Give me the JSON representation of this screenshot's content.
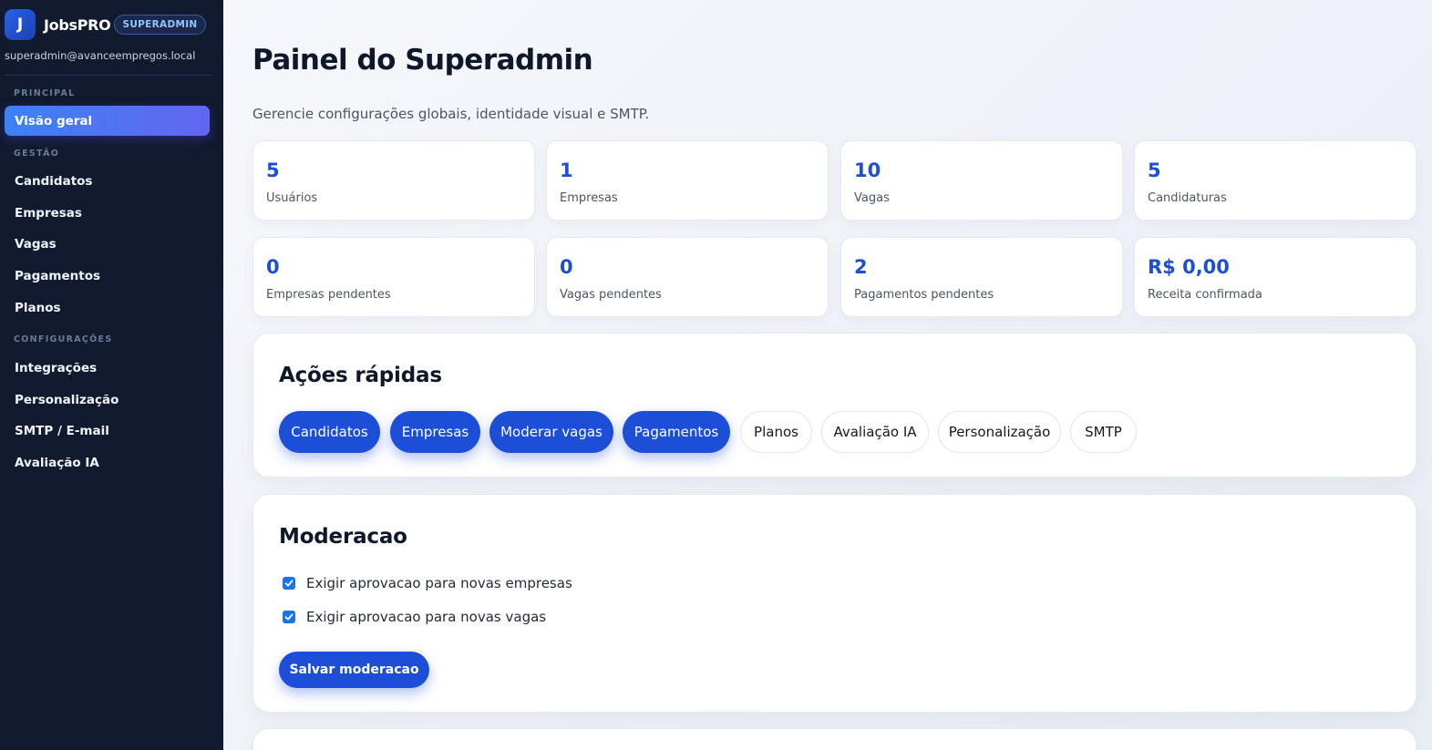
{
  "brand": {
    "logo_letter": "J",
    "name": "JobsPRO",
    "role_badge": "SUPERADMIN"
  },
  "user": {
    "email": "superadmin@avanceempregos.local"
  },
  "sidebar": {
    "sections": [
      {
        "label": "PRINCIPAL",
        "items": [
          {
            "label": "Visão geral",
            "active": true
          }
        ]
      },
      {
        "label": "GESTÃO",
        "items": [
          {
            "label": "Candidatos"
          },
          {
            "label": "Empresas"
          },
          {
            "label": "Vagas"
          },
          {
            "label": "Pagamentos"
          },
          {
            "label": "Planos"
          }
        ]
      },
      {
        "label": "CONFIGURAÇÕES",
        "items": [
          {
            "label": "Integrações"
          },
          {
            "label": "Personalização"
          },
          {
            "label": "SMTP / E-mail"
          },
          {
            "label": "Avaliação IA"
          }
        ]
      }
    ]
  },
  "page": {
    "title": "Painel do Superadmin",
    "subtitle": "Gerencie configurações globais, identidade visual e SMTP."
  },
  "stats": [
    {
      "value": "5",
      "label": "Usuários"
    },
    {
      "value": "1",
      "label": "Empresas"
    },
    {
      "value": "10",
      "label": "Vagas"
    },
    {
      "value": "5",
      "label": "Candidaturas"
    },
    {
      "value": "0",
      "label": "Empresas pendentes"
    },
    {
      "value": "0",
      "label": "Vagas pendentes"
    },
    {
      "value": "2",
      "label": "Pagamentos pendentes"
    },
    {
      "value": "R$ 0,00",
      "label": "Receita confirmada"
    }
  ],
  "quick_actions": {
    "title": "Ações rápidas",
    "buttons": [
      {
        "label": "Candidatos",
        "style": "primary"
      },
      {
        "label": "Empresas",
        "style": "primary"
      },
      {
        "label": "Moderar vagas",
        "style": "primary"
      },
      {
        "label": "Pagamentos",
        "style": "primary"
      },
      {
        "label": "Planos",
        "style": "outline"
      },
      {
        "label": "Avaliação IA",
        "style": "outline"
      },
      {
        "label": "Personalização",
        "style": "outline"
      },
      {
        "label": "SMTP",
        "style": "outline"
      }
    ]
  },
  "moderation": {
    "title": "Moderacao",
    "options": [
      {
        "label": "Exigir aprovacao para novas empresas",
        "checked": true
      },
      {
        "label": "Exigir aprovacao para novas vagas",
        "checked": true
      }
    ],
    "save_label": "Salvar moderacao"
  },
  "colors": {
    "sidebar_bg": "#111a2e",
    "accent": "#1d4ed8",
    "checkbox": "#1a73e8"
  }
}
